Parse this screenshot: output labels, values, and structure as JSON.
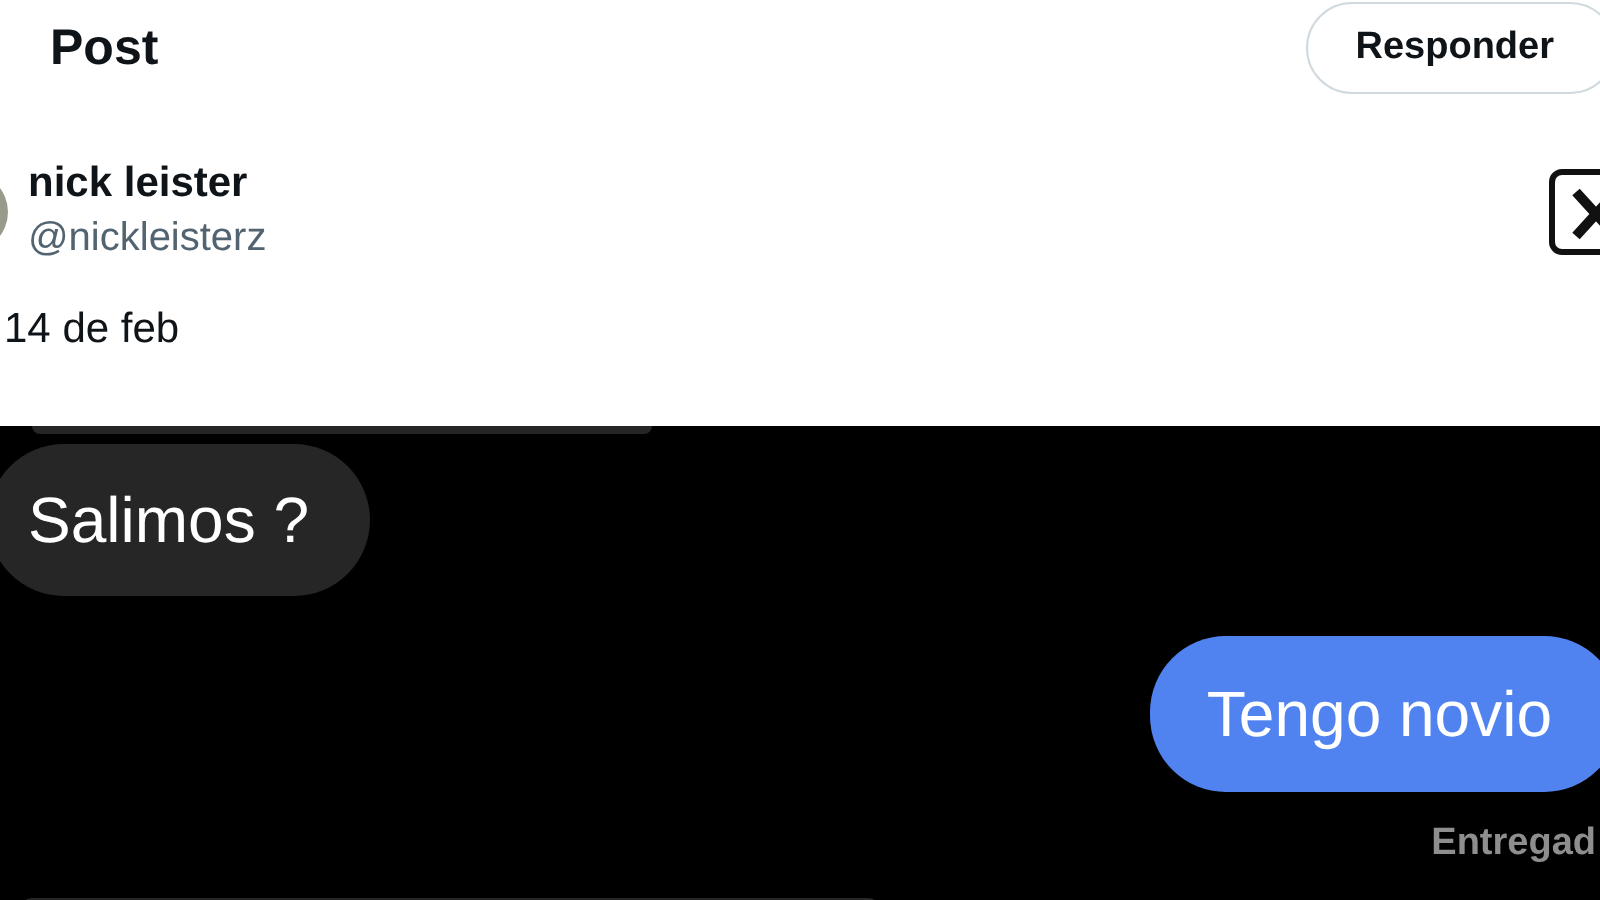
{
  "header": {
    "title": "Post",
    "reply_button": "Responder"
  },
  "post": {
    "author_name": "nick leister",
    "author_handle": "@nickleisterz",
    "date": "14 de feb"
  },
  "chat": {
    "messages": [
      {
        "kind": "received",
        "text": "Salimos ?"
      },
      {
        "kind": "sent",
        "text": "Tengo novio"
      }
    ],
    "status": "Entregad"
  }
}
